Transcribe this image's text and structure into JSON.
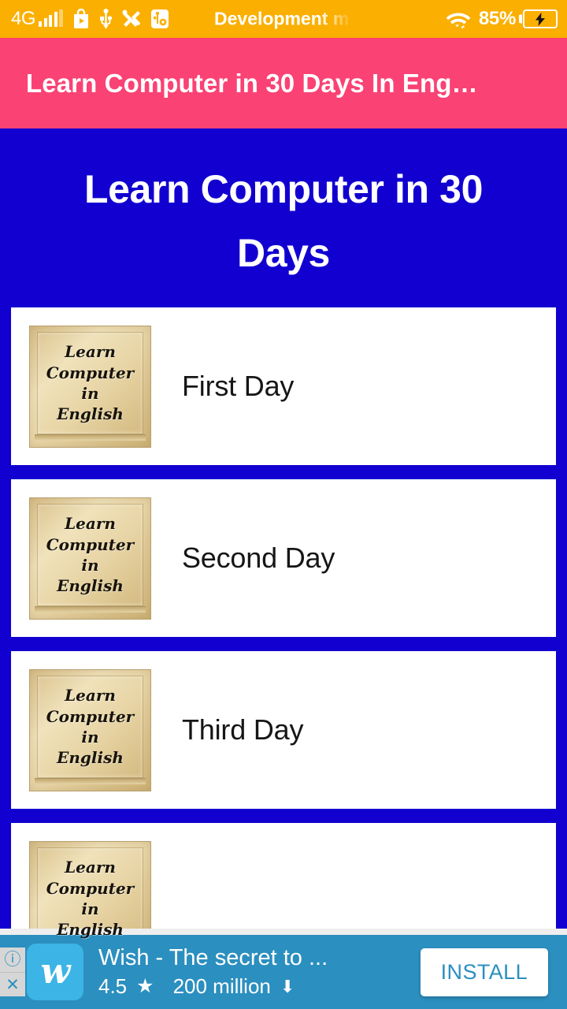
{
  "status_bar": {
    "background_color": "#FBAF00",
    "network_type": "4G",
    "icons": [
      "signal-bars-icon",
      "play-store-icon",
      "usb-icon",
      "developer-tools-icon",
      "usb-debugging-icon",
      "wifi-icon"
    ],
    "notification_title": "Development m",
    "battery_percent": "85%",
    "battery_state": "charging"
  },
  "app_bar": {
    "title": "Learn Computer in 30 Days In Eng…",
    "background_color": "#FA4274"
  },
  "main": {
    "background_color": "#1100D0",
    "heading": "Learn Computer in 30 Days",
    "thumbnail_text_lines": [
      "Learn",
      "Computer",
      "in",
      "English"
    ],
    "cards": [
      {
        "label": "First Day",
        "thumbnail_alt": "Learn Computer in English"
      },
      {
        "label": "Second Day",
        "thumbnail_alt": "Learn Computer in English"
      },
      {
        "label": "Third Day",
        "thumbnail_alt": "Learn Computer in English"
      },
      {
        "label": "",
        "thumbnail_alt": "Learn Computer in English"
      }
    ]
  },
  "ad_banner": {
    "background_color": "#2B8FBF",
    "info_badge": "ⓘ",
    "close_badge": "✕",
    "app_icon_letter": "w",
    "app_title": "Wish - The secret to ...",
    "rating": "4.5",
    "star_icon": "★",
    "downloads": "200 million",
    "download_icon": "⬇",
    "install_label": "INSTALL"
  }
}
